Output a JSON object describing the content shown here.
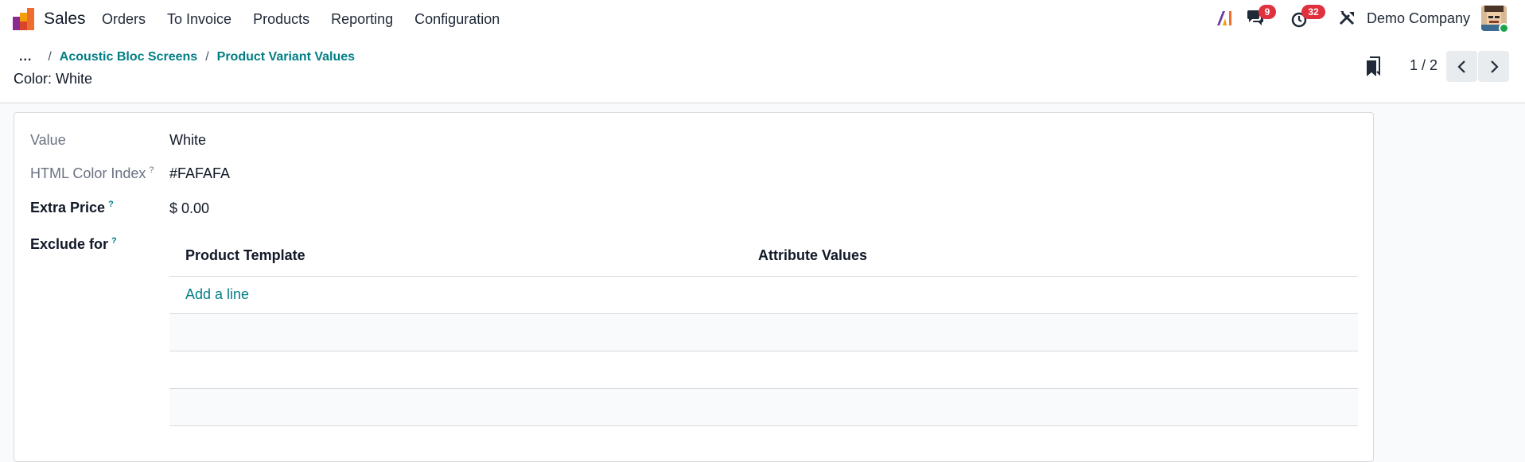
{
  "navbar": {
    "app_name": "Sales",
    "menu": [
      "Orders",
      "To Invoice",
      "Products",
      "Reporting",
      "Configuration"
    ],
    "chat_count": "9",
    "activity_count": "32",
    "company": "Demo Company",
    "icons": {
      "app": "sales-app-icon",
      "ai": "ai-icon",
      "chat": "chat-icon",
      "activity": "activity-clock-icon",
      "tools": "debug-tools-icon"
    }
  },
  "control": {
    "breadcrumb_dots": "...",
    "breadcrumbs": [
      "Acoustic Bloc Screens",
      "Product Variant Values"
    ],
    "separator": "/",
    "record_title": "Color: White",
    "pager": "1 / 2"
  },
  "form": {
    "value_label": "Value",
    "value": "White",
    "color_label": "HTML Color Index",
    "color_value": "#FAFAFA",
    "price_label": "Extra Price",
    "price_value": "$ 0.00",
    "exclude_label": "Exclude for",
    "help_mark": "?",
    "table": {
      "columns": [
        "Product Template",
        "Attribute Values"
      ],
      "add_line": "Add a line"
    }
  },
  "colors": {
    "accent": "#017e84",
    "badge": "#e0313e",
    "status_online": "#1ba34a"
  }
}
